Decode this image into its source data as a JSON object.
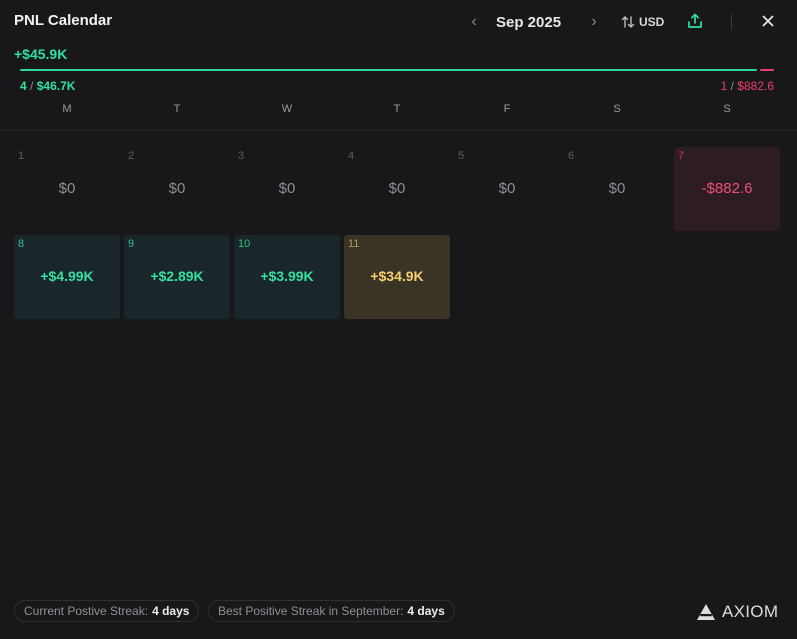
{
  "header": {
    "title": "PNL Calendar",
    "month": "Sep 2025",
    "prev_icon": "chevron-left-icon",
    "next_icon": "chevron-right-icon",
    "currency": "USD",
    "swap_icon": "swap-icon",
    "share_icon": "share-icon",
    "close_icon": "close-icon"
  },
  "summary": {
    "total": "+$45.9K",
    "win_count": "4",
    "win_amount": "$46.7K",
    "loss_count": "1",
    "loss_amount": "$882.6",
    "separator": "/",
    "win_ratio": 0.981
  },
  "weekdays": [
    "M",
    "T",
    "W",
    "T",
    "F",
    "S",
    "S"
  ],
  "days": [
    {
      "num": "1",
      "value": "$0",
      "kind": "zero"
    },
    {
      "num": "2",
      "value": "$0",
      "kind": "zero"
    },
    {
      "num": "3",
      "value": "$0",
      "kind": "zero"
    },
    {
      "num": "4",
      "value": "$0",
      "kind": "zero"
    },
    {
      "num": "5",
      "value": "$0",
      "kind": "zero"
    },
    {
      "num": "6",
      "value": "$0",
      "kind": "zero"
    },
    {
      "num": "7",
      "value": "-$882.6",
      "kind": "neg"
    },
    {
      "num": "8",
      "value": "+$4.99K",
      "kind": "pos"
    },
    {
      "num": "9",
      "value": "+$2.89K",
      "kind": "pos"
    },
    {
      "num": "10",
      "value": "+$3.99K",
      "kind": "pos"
    },
    {
      "num": "11",
      "value": "+$34.9K",
      "kind": "best"
    }
  ],
  "footer": {
    "current_streak_label": "Current Postive Streak:",
    "current_streak_value": "4 days",
    "best_streak_label": "Best Positive Streak in September:",
    "best_streak_value": "4 days",
    "logo_text": "AXIOM",
    "logo_icon": "axiom-logo-icon"
  },
  "colors": {
    "positive": "#2fe0a0",
    "negative": "#ec3f6e",
    "best": "#f6cf6f",
    "background": "#18181a"
  }
}
